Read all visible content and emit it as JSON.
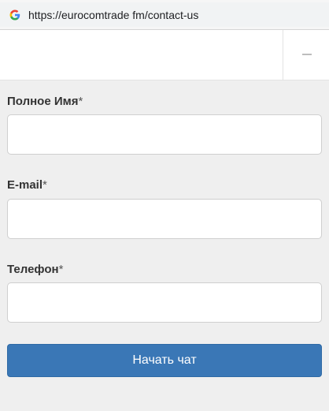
{
  "browser": {
    "url": "https://eurocomtrade fm/contact-us",
    "favicon_icon": "google-g-icon"
  },
  "chat_header": {
    "minimize_icon": "minimize-icon"
  },
  "form": {
    "fields": [
      {
        "label": "Полное Имя",
        "required_mark": "*",
        "value": ""
      },
      {
        "label": "E-mail",
        "required_mark": "*",
        "value": ""
      },
      {
        "label": "Телефон",
        "required_mark": "*",
        "value": ""
      }
    ],
    "submit_label": "Начать чат"
  },
  "colors": {
    "accent": "#3a77b6",
    "background": "#efefef"
  }
}
